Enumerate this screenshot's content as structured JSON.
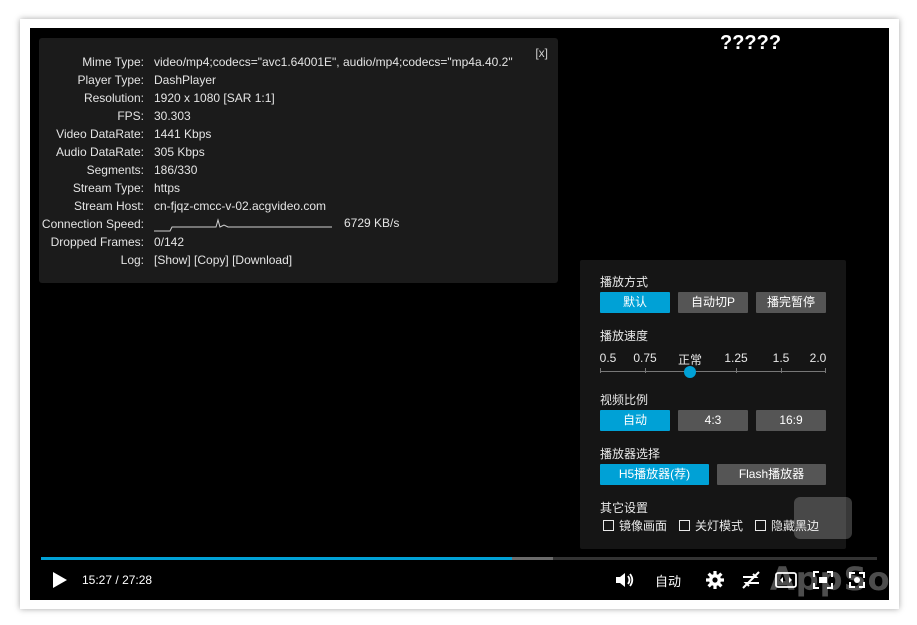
{
  "overlay_title": "?????",
  "stats": {
    "close_label": "[x]",
    "rows": [
      {
        "label": "Mime Type:",
        "value": "video/mp4;codecs=\"avc1.64001E\", audio/mp4;codecs=\"mp4a.40.2\""
      },
      {
        "label": "Player Type:",
        "value": "DashPlayer"
      },
      {
        "label": "Resolution:",
        "value": "1920 x 1080 [SAR 1:1]"
      },
      {
        "label": "FPS:",
        "value": "30.303"
      },
      {
        "label": "Video DataRate:",
        "value": "1441 Kbps"
      },
      {
        "label": "Audio DataRate:",
        "value": "305 Kbps"
      },
      {
        "label": "Segments:",
        "value": "186/330"
      },
      {
        "label": "Stream Type:",
        "value": "https"
      },
      {
        "label": "Stream Host:",
        "value": "cn-fjqz-cmcc-v-02.acgvideo.com"
      }
    ],
    "connection_speed": {
      "label": "Connection Speed:",
      "value": "6729 KB/s"
    },
    "dropped_frames": {
      "label": "Dropped Frames:",
      "value": "0/142"
    },
    "log": {
      "label": "Log:",
      "show": "[Show]",
      "copy": "[Copy]",
      "download": "[Download]"
    }
  },
  "settings": {
    "play_mode": {
      "title": "播放方式",
      "options": [
        "默认",
        "自动切P",
        "播完暂停"
      ],
      "selected": 0
    },
    "speed": {
      "title": "播放速度",
      "labels": [
        "0.5",
        "0.75",
        "正常",
        "1.25",
        "1.5",
        "2.0"
      ],
      "selected": "正常"
    },
    "ratio": {
      "title": "视频比例",
      "options": [
        "自动",
        "4:3",
        "16:9"
      ],
      "selected": 0
    },
    "player_select": {
      "title": "播放器选择",
      "options": [
        "H5播放器(荐)",
        "Flash播放器"
      ],
      "selected": 0
    },
    "other": {
      "title": "其它设置",
      "checks": [
        "镜像画面",
        "关灯模式",
        "隐藏黑边"
      ]
    }
  },
  "playback": {
    "current": "15:27",
    "separator": "/",
    "duration": "27:28",
    "progress_fraction": 0.563,
    "buffer_fraction": 0.612,
    "quality_label": "自动"
  },
  "watermark": "AppSo",
  "colors": {
    "accent": "#00a1d6",
    "panel": "#1b1b1b",
    "button": "#555555"
  }
}
